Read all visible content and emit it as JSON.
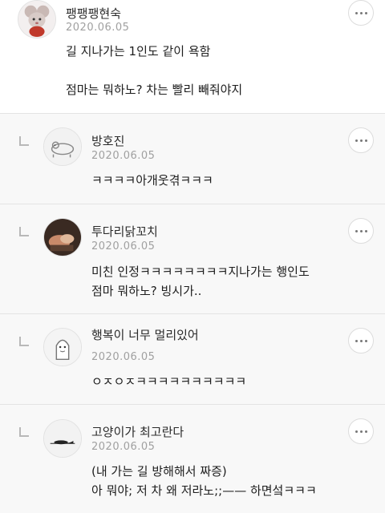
{
  "comments": [
    {
      "author": "팽팽팽현숙",
      "date": "2020.06.05",
      "lines": [
        "길 지나가는 1인도 같이 욕함",
        "",
        "점마는 뭐하노? 차는 빨리 빼줘야지"
      ],
      "avatar_icon": "mouse-cartoon-avatar-icon",
      "more_icon": "more-options-icon"
    },
    {
      "author": "방호진",
      "date": "2020.06.05",
      "lines": [
        "ㅋㅋㅋㅋ아개웃겪ㅋㅋㅋ"
      ],
      "avatar_icon": "animal-doodle-avatar-icon",
      "more_icon": "more-options-icon"
    },
    {
      "author": "투다리닭꼬치",
      "date": "2020.06.05",
      "lines": [
        "미친 인정ㅋㅋㅋㅋㅋㅋㅋㅋ지나가는 행인도",
        "점마 뭐하노? 빙시가.."
      ],
      "avatar_icon": "photo-avatar-icon",
      "more_icon": "more-options-icon"
    },
    {
      "author": "행복이 너무 멀리있어",
      "date": "2020.06.05",
      "lines": [
        "ㅇㅈㅇㅈㅋㅋㅋㅋㅋㅋㅋㅋㅋㅋ"
      ],
      "avatar_icon": "character-avatar-icon",
      "more_icon": "more-options-icon"
    },
    {
      "author": "고양이가 최고란다",
      "date": "2020.06.05",
      "lines": [
        "(내 가는 길 방해해서 짜증)",
        "아 뭐야; 저 차 왜 저라노;;—— 하면섴ㅋㅋㅋ"
      ],
      "avatar_icon": "cat-silhouette-avatar-icon",
      "more_icon": "more-options-icon"
    }
  ],
  "colors": {
    "reply_background": "#f8f8f8",
    "divider": "#e3e3e3",
    "date_text": "#a0a0a0"
  }
}
